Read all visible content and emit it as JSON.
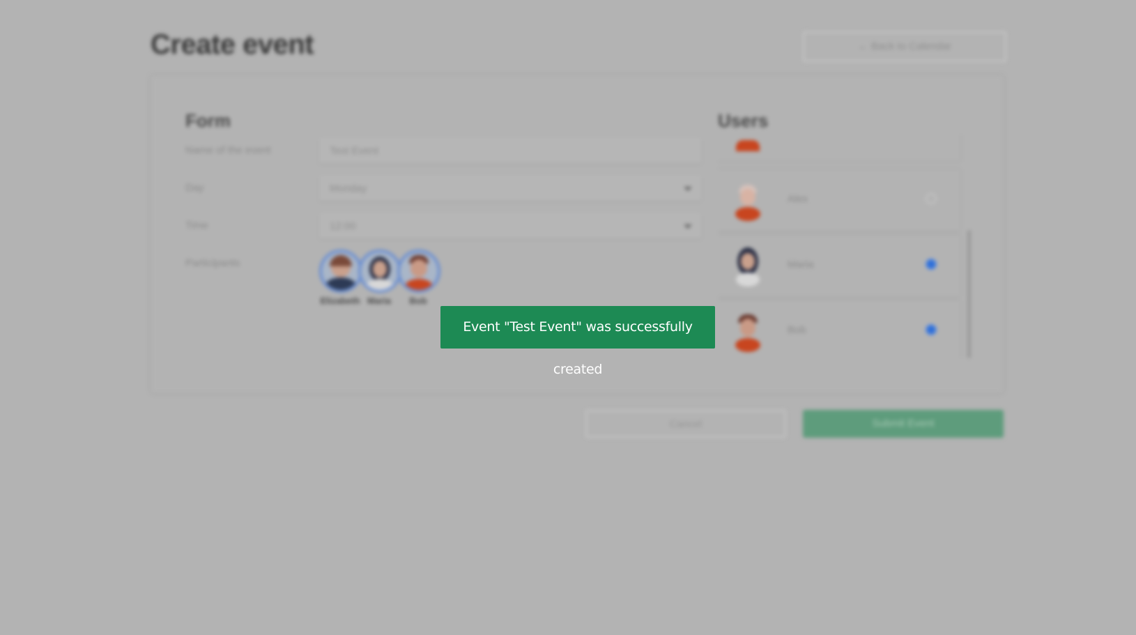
{
  "header": {
    "title": "Create event",
    "back_label": "← Back to Calendar"
  },
  "form": {
    "section_title": "Form",
    "name_label": "Name of the event",
    "name_value": "Test Event",
    "day_label": "Day",
    "day_value": "Monday",
    "time_label": "Time",
    "time_value": "12:00",
    "participants_label": "Participants",
    "participants": [
      {
        "name": "Elizabeth"
      },
      {
        "name": "Maria"
      },
      {
        "name": "Bob"
      }
    ]
  },
  "users": {
    "section_title": "Users",
    "items": [
      {
        "name": "",
        "checked": false
      },
      {
        "name": "Alex",
        "checked": false
      },
      {
        "name": "Maria",
        "checked": true
      },
      {
        "name": "Bob",
        "checked": true
      }
    ]
  },
  "actions": {
    "cancel_label": "Cancel",
    "submit_label": "Submit Event"
  },
  "toast": {
    "message": "Event \"Test Event\" was successfully created"
  },
  "colors": {
    "overlay": "#b3b3b3",
    "toast_bg": "#1d8a54",
    "accent": "#2f6fd8"
  }
}
